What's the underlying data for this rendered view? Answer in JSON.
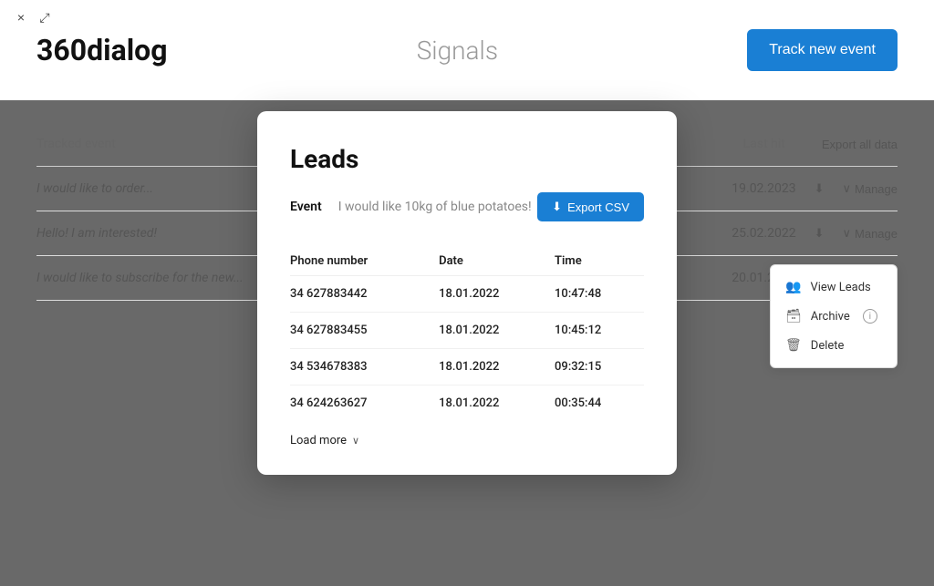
{
  "app": {
    "title": "360dialog",
    "signals_label": "Signals",
    "track_btn_label": "Track new event"
  },
  "window_controls": {
    "close_label": "×",
    "expand_label": "⤢"
  },
  "background_table": {
    "col_tracked_event": "Tracked event",
    "col_last_hit": "Last hit",
    "col_export": "Export all data",
    "rows": [
      {
        "event": "I would like to order...",
        "date": "19.02.2023"
      },
      {
        "event": "Hello! I am interested!",
        "date": "25.02.2022"
      },
      {
        "event": "I would like to subscribe for the new...",
        "date": "20.01.2023"
      }
    ],
    "manage_label": "Manage",
    "manage_open_label": "Manage"
  },
  "context_menu": {
    "view_leads": "View Leads",
    "archive": "Archive",
    "archive_info": "i",
    "delete": "Delete"
  },
  "modal": {
    "title": "Leads",
    "event_label": "Event",
    "event_value": "I would like 10kg of blue potatoes!",
    "export_csv_label": "Export CSV",
    "table": {
      "col_phone": "Phone number",
      "col_date": "Date",
      "col_time": "Time",
      "rows": [
        {
          "phone": "34 627883442",
          "date": "18.01.2022",
          "time": "10:47:48"
        },
        {
          "phone": "34 627883455",
          "date": "18.01.2022",
          "time": "10:45:12"
        },
        {
          "phone": "34 534678383",
          "date": "18.01.2022",
          "time": "09:32:15"
        },
        {
          "phone": "34 624263627",
          "date": "18.01.2022",
          "time": "00:35:44"
        }
      ]
    },
    "load_more": "Load more"
  },
  "colors": {
    "accent": "#1a7fd4"
  }
}
